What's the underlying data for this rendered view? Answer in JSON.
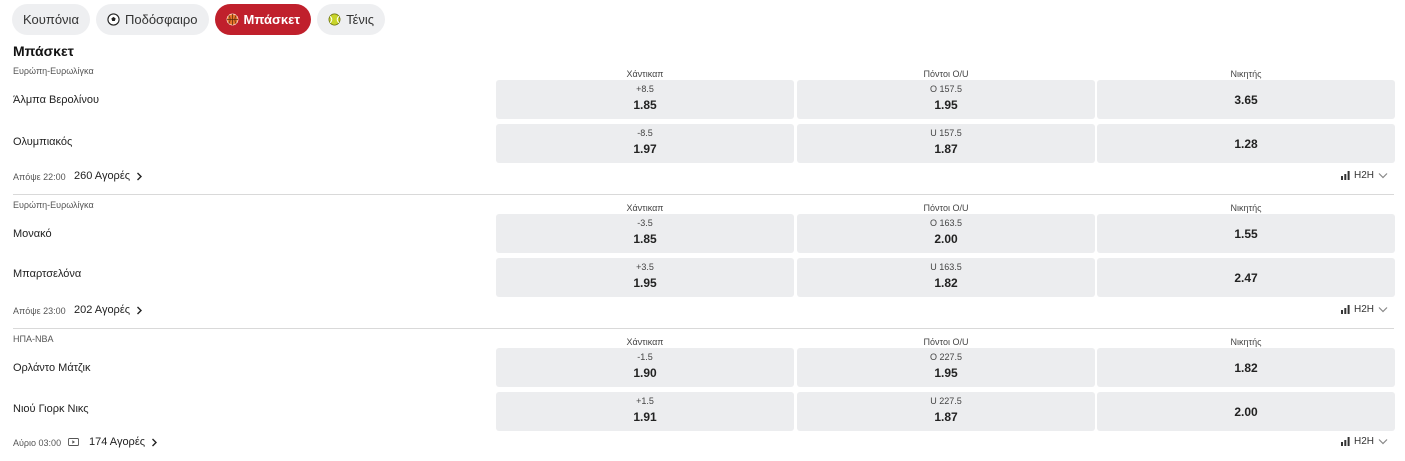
{
  "tabs": [
    {
      "label": "Κουπόνια",
      "icon": "none"
    },
    {
      "label": "Ποδόσφαιρο",
      "icon": "soccer-ball-icon"
    },
    {
      "label": "Μπάσκετ",
      "icon": "basketball-icon",
      "active": true
    },
    {
      "label": "Τένις",
      "icon": "tennis-ball-icon"
    }
  ],
  "section_title": "Μπάσκετ",
  "column_headers": {
    "handicap": "Χάντικαπ",
    "totals": "Πόντοι Ο/U",
    "winner": "Νικητής"
  },
  "h2h_label": "H2H",
  "accent_color": "#c0202c",
  "matches": [
    {
      "league": "Ευρώπη-Ευρωλίγκα",
      "time": "Απόψε 22:00",
      "markets": "260 Αγορές",
      "home": {
        "name": "Άλμπα Βερολίνου",
        "hcp_line": "+8.5",
        "hcp_price": "1.85",
        "tot_line": "O 157.5",
        "tot_price": "1.95",
        "win": "3.65"
      },
      "away": {
        "name": "Ολυμπιακός",
        "hcp_line": "-8.5",
        "hcp_price": "1.97",
        "tot_line": "U 157.5",
        "tot_price": "1.87",
        "win": "1.28"
      }
    },
    {
      "league": "Ευρώπη-Ευρωλίγκα",
      "time": "Απόψε 23:00",
      "markets": "202 Αγορές",
      "home": {
        "name": "Μονακό",
        "hcp_line": "-3.5",
        "hcp_price": "1.85",
        "tot_line": "O 163.5",
        "tot_price": "2.00",
        "win": "1.55"
      },
      "away": {
        "name": "Μπαρτσελόνα",
        "hcp_line": "+3.5",
        "hcp_price": "1.95",
        "tot_line": "U 163.5",
        "tot_price": "1.82",
        "win": "2.47"
      }
    },
    {
      "league": "ΗΠΑ-NBA",
      "time": "Αύριο 03:00",
      "markets": "174 Αγορές",
      "has_tv": true,
      "home": {
        "name": "Ορλάντο Μάτζικ",
        "hcp_line": "-1.5",
        "hcp_price": "1.90",
        "tot_line": "O 227.5",
        "tot_price": "1.95",
        "win": "1.82"
      },
      "away": {
        "name": "Νιού Γιορκ Νικς",
        "hcp_line": "+1.5",
        "hcp_price": "1.91",
        "tot_line": "U 227.5",
        "tot_price": "1.87",
        "win": "2.00"
      }
    }
  ]
}
